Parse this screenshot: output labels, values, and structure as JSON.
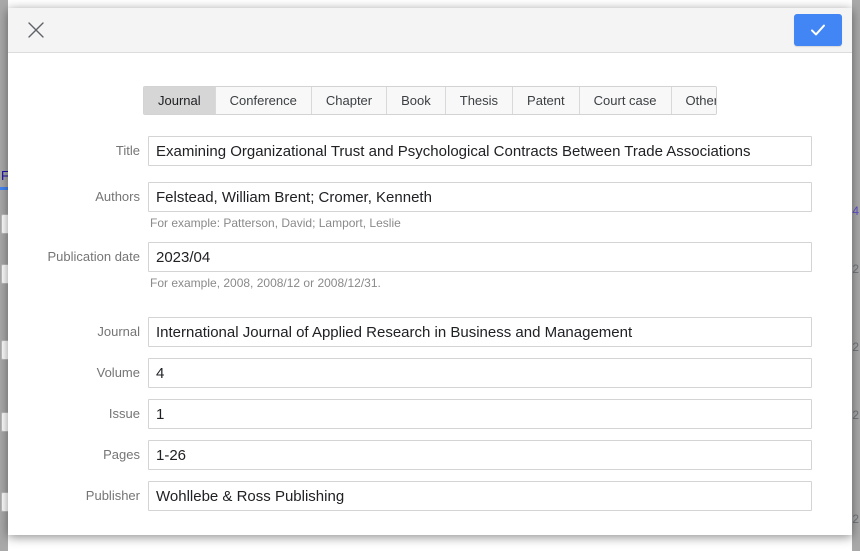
{
  "backdrop": {
    "left_link": "F",
    "right_numbers": [
      "4",
      "2",
      "2",
      "2",
      "2"
    ]
  },
  "dialog": {
    "close_icon": "close-icon",
    "close_label": "Close",
    "save_icon": "check-icon",
    "save_label": "Save"
  },
  "tabs": [
    {
      "label": "Journal",
      "selected": true
    },
    {
      "label": "Conference",
      "selected": false
    },
    {
      "label": "Chapter",
      "selected": false
    },
    {
      "label": "Book",
      "selected": false
    },
    {
      "label": "Thesis",
      "selected": false
    },
    {
      "label": "Patent",
      "selected": false
    },
    {
      "label": "Court case",
      "selected": false
    },
    {
      "label": "Other",
      "selected": false
    }
  ],
  "fields": {
    "title": {
      "label": "Title",
      "value": "Examining Organizational Trust and Psychological Contracts Between Trade Associations"
    },
    "authors": {
      "label": "Authors",
      "value": "Felstead, William Brent; Cromer, Kenneth",
      "hint": "For example: Patterson, David; Lamport, Leslie"
    },
    "publication_date": {
      "label": "Publication date",
      "value": "2023/04",
      "hint": "For example, 2008, 2008/12 or 2008/12/31."
    },
    "journal": {
      "label": "Journal",
      "value": "International Journal of Applied Research in Business and Management"
    },
    "volume": {
      "label": "Volume",
      "value": "4"
    },
    "issue": {
      "label": "Issue",
      "value": "1"
    },
    "pages": {
      "label": "Pages",
      "value": "1-26"
    },
    "publisher": {
      "label": "Publisher",
      "value": "Wohllebe & Ross Publishing"
    }
  },
  "colors": {
    "accent": "#4285f4",
    "header_bg": "#f4f4f4",
    "tab_selected_bg": "#d6d6d6",
    "label_text": "#757575"
  }
}
